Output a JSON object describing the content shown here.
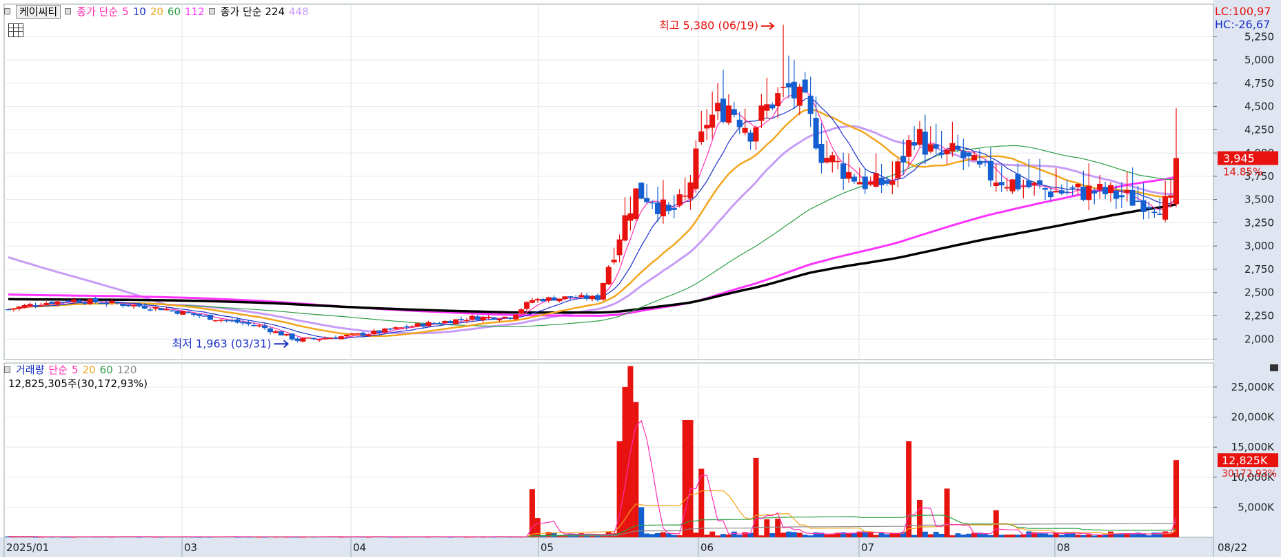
{
  "header": {
    "stock_name": "케이씨티",
    "ma_label": "종가 단순",
    "ma_periods": [
      "5",
      "10",
      "20",
      "60",
      "112"
    ],
    "long_ma_label": "종가 단순 224",
    "long_ma_period2": "448"
  },
  "volume_header": {
    "label": "거래량",
    "ma_label": "단순",
    "ma_periods": [
      "5",
      "20",
      "60",
      "120"
    ],
    "value_text": "12,825,305주(30,172,93%)"
  },
  "readouts": {
    "lc": "LC:100,97",
    "hc": "HC:-26,67",
    "price_tag": "3,945",
    "price_change": "14.85%",
    "volume_tag": "12,825K",
    "volume_pct": "30172.93%"
  },
  "annotations": {
    "high": "최고 5,380 (06/19)",
    "low": "최저 1,963 (03/31)"
  },
  "x_axis": {
    "labels": [
      "2025/01",
      "03",
      "04",
      "05",
      "06",
      "07",
      "08"
    ],
    "last_date": "08/22"
  },
  "colors": {
    "up": "#e8120f",
    "down": "#1560d0",
    "ma5": "#ff2db0",
    "ma10": "#1a2fc8",
    "ma20": "#f2a51b",
    "ma60": "#2a9e44",
    "ma112": "#ff33ff",
    "ma224": "#000000",
    "ma448": "#c79cf7"
  },
  "chart_data": [
    {
      "type": "candlestick",
      "title": "",
      "y_ticks": [
        2000,
        2250,
        2500,
        2750,
        3000,
        3250,
        3500,
        3750,
        4000,
        4250,
        4500,
        4750,
        5000,
        5250
      ],
      "y_tick_labels": [
        "2,000",
        "2,250",
        "2,500",
        "2,750",
        "3,000",
        "3,250",
        "3,500",
        "3,750",
        "4,000",
        "4,250",
        "4,500",
        "4,750",
        "5,000",
        "5,250"
      ],
      "ylim": [
        1780,
        5600
      ],
      "high": {
        "value": 5380,
        "date": "06/19"
      },
      "low": {
        "value": 1963,
        "date": "03/31"
      },
      "last_close": 3945,
      "change_pct": 14.85,
      "moving_averages": [
        "5",
        "10",
        "20",
        "60",
        "112",
        "224",
        "448"
      ],
      "grid": true
    },
    {
      "type": "bar",
      "title": "",
      "y_ticks": [
        5000,
        10000,
        15000,
        20000,
        25000
      ],
      "y_tick_labels": [
        "5,000K",
        "10,000K",
        "15,000K",
        "20,000K",
        "25,000K"
      ],
      "ylim": [
        0,
        29000
      ],
      "unit": "K",
      "last_volume": 12825,
      "moving_averages": [
        "5",
        "20",
        "60",
        "120"
      ],
      "grid": true
    }
  ]
}
